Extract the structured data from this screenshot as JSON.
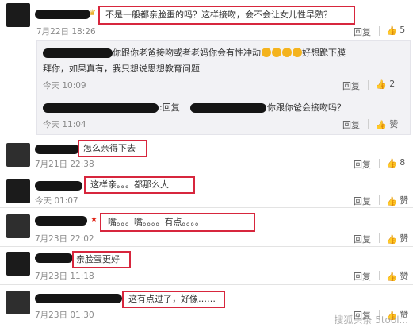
{
  "actions": {
    "reply": "回复",
    "like_icon": "thumbs-up-icon"
  },
  "c1": {
    "text": "不是一般都亲脸蛋的吗？这样接吻，会不会让女儿性早熟？",
    "time": "7月22日 18:26",
    "likes": "5"
  },
  "n1": {
    "text1": "你跟你老爸接吻或者老妈你会有性冲动",
    "text2": "好想跪下膜",
    "text3": "拜你，如果真有，我只想说思想教育问题",
    "time": "今天 10:09",
    "likes": "2"
  },
  "n2": {
    "prefix": ":回复",
    "text": "你跟你爸会接吻吗？",
    "time": "今天 11:04",
    "likes": "赞"
  },
  "c2": {
    "text": "怎么亲得下去",
    "time": "7月21日 22:38",
    "likes": "8"
  },
  "c3": {
    "text": "这样亲。。。都那么大",
    "time": "今天 01:07",
    "likes": "赞"
  },
  "c4": {
    "text": "嘴。。。嘴。。。。有点。。。。",
    "time": "7月23日 22:02",
    "likes": "赞"
  },
  "c5": {
    "text": "亲脸蛋更好",
    "time": "7月23日 11:18",
    "likes": "赞"
  },
  "c6": {
    "text": "这有点过了，好像……",
    "time": "7月23日 01:30",
    "likes": "赞"
  },
  "watermark": "搜狐头条 5tool..."
}
